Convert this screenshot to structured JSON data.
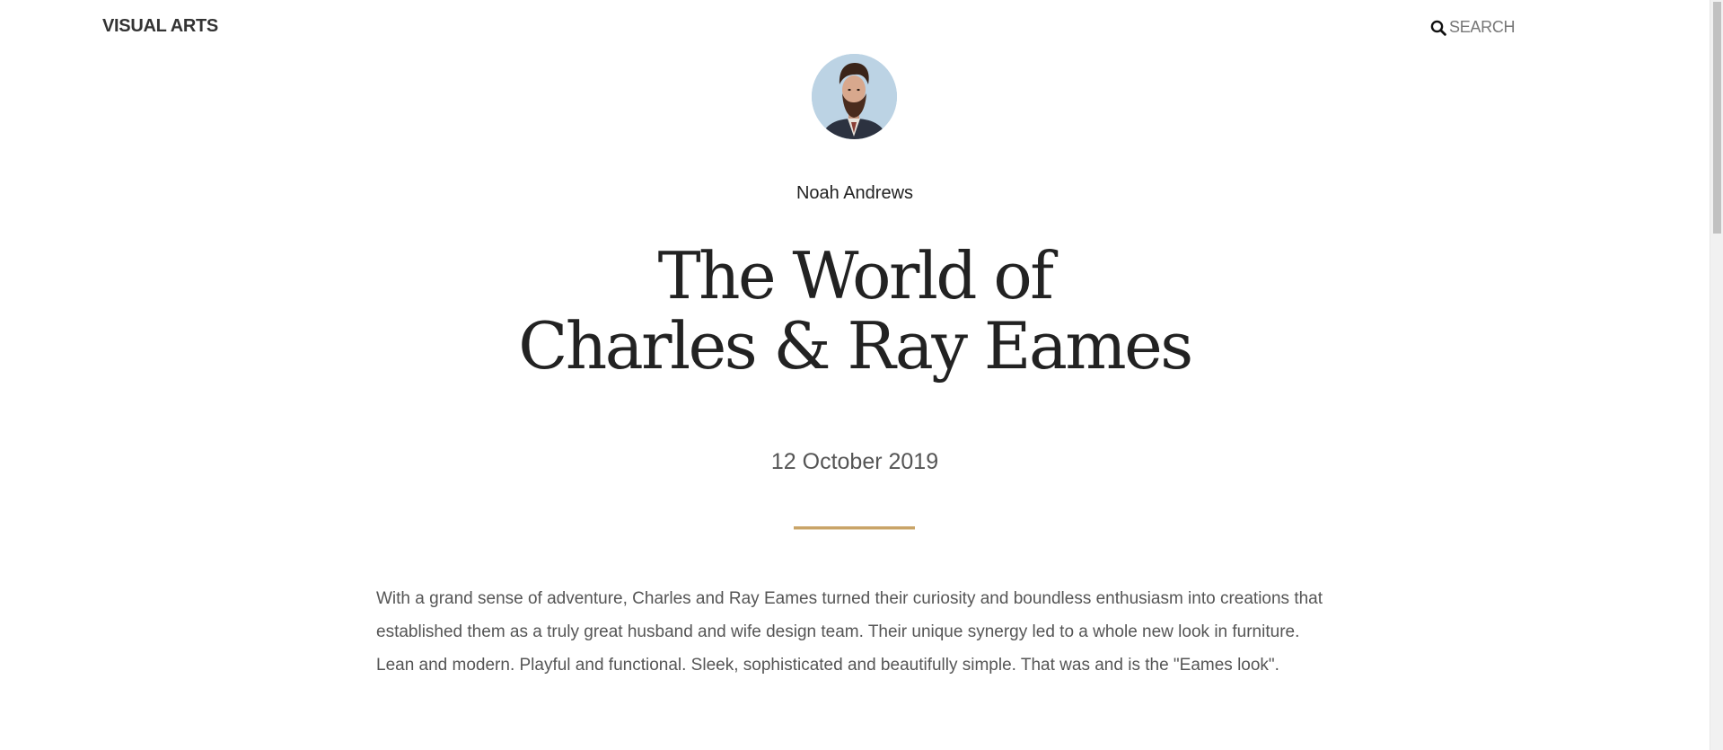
{
  "header": {
    "site_title": "VISUAL ARTS",
    "search_label": "SEARCH",
    "search_icon": "search-icon"
  },
  "article": {
    "author": "Noah Andrews",
    "title_line1": "The World of",
    "title_line2": "Charles & Ray Eames",
    "date": "12 October 2019",
    "body": "With a grand sense of adventure, Charles and Ray Eames turned their curiosity and boundless enthusiasm into creations that established them as a truly great husband and wife design team. Their unique synergy led to a whole new look in furniture. Lean and modern. Playful and functional. Sleek, sophisticated and beautifully simple. That was and is the \"Eames look\"."
  },
  "colors": {
    "accent_divider": "#c9a468",
    "text_dark": "#222222",
    "text_muted": "#555555",
    "avatar_bg": "#b8d0e2"
  }
}
